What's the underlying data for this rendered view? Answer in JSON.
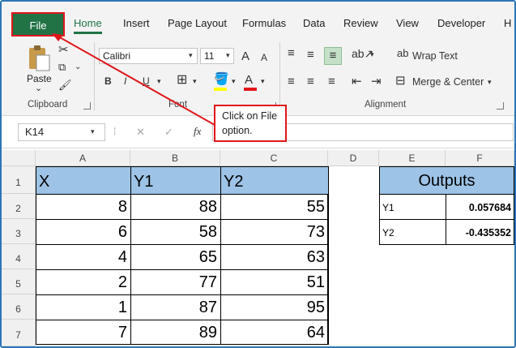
{
  "tabs": [
    "File",
    "Home",
    "Insert",
    "Page Layout",
    "Formulas",
    "Data",
    "Review",
    "View",
    "Developer",
    "H"
  ],
  "ribbon": {
    "paste_label": "Paste",
    "paste_arrow": "⌄",
    "clipboard_label": "Clipboard",
    "font_name": "Calibri",
    "font_size": "11",
    "font_label": "Font",
    "bold": "B",
    "italic": "I",
    "underline": "U",
    "grow_font": "A",
    "shrink_font": "A",
    "font_color_letter": "A",
    "wrap_text": "Wrap Text",
    "merge_center": "Merge & Center",
    "alignment_label": "Alignment",
    "colors": {
      "accent": "#217346",
      "highlight": "#ffff00",
      "font_color": "#e0161b"
    }
  },
  "formula_bar": {
    "name_box": "K14",
    "fx": "fx",
    "cancel": "✕",
    "enter": "✓"
  },
  "callout": {
    "text": "Click on File option."
  },
  "columns": [
    "A",
    "B",
    "C",
    "D",
    "E",
    "F"
  ],
  "rows": [
    "1",
    "2",
    "3",
    "4",
    "5",
    "6",
    "7"
  ],
  "table": {
    "headers": [
      "X",
      "Y1",
      "Y2"
    ],
    "data": [
      [
        "8",
        "88",
        "55"
      ],
      [
        "6",
        "58",
        "73"
      ],
      [
        "4",
        "65",
        "63"
      ],
      [
        "2",
        "77",
        "51"
      ],
      [
        "1",
        "87",
        "95"
      ],
      [
        "7",
        "89",
        "64"
      ]
    ]
  },
  "outputs": {
    "title": "Outputs",
    "rows": [
      {
        "label": "Y1",
        "value": "0.057684"
      },
      {
        "label": "Y2",
        "value": "-0.435352"
      }
    ]
  }
}
